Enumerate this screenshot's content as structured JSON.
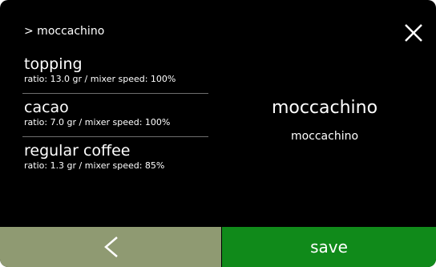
{
  "breadcrumb": "> moccachino",
  "ingredients": [
    {
      "name": "topping",
      "detail": "ratio: 13.0 gr / mixer speed: 100%"
    },
    {
      "name": "cacao",
      "detail": "ratio: 7.0 gr / mixer speed: 100%"
    },
    {
      "name": "regular coffee",
      "detail": "ratio: 1.3 gr / mixer speed: 85%"
    }
  ],
  "product": {
    "title": "moccachino",
    "subtitle": "moccachino"
  },
  "footer": {
    "save_label": "save"
  },
  "icons": {
    "close": "close-icon",
    "back": "chevron-left-icon"
  },
  "colors": {
    "back_button": "#8f9a72",
    "save_button": "#108a1a",
    "background": "#000000"
  }
}
